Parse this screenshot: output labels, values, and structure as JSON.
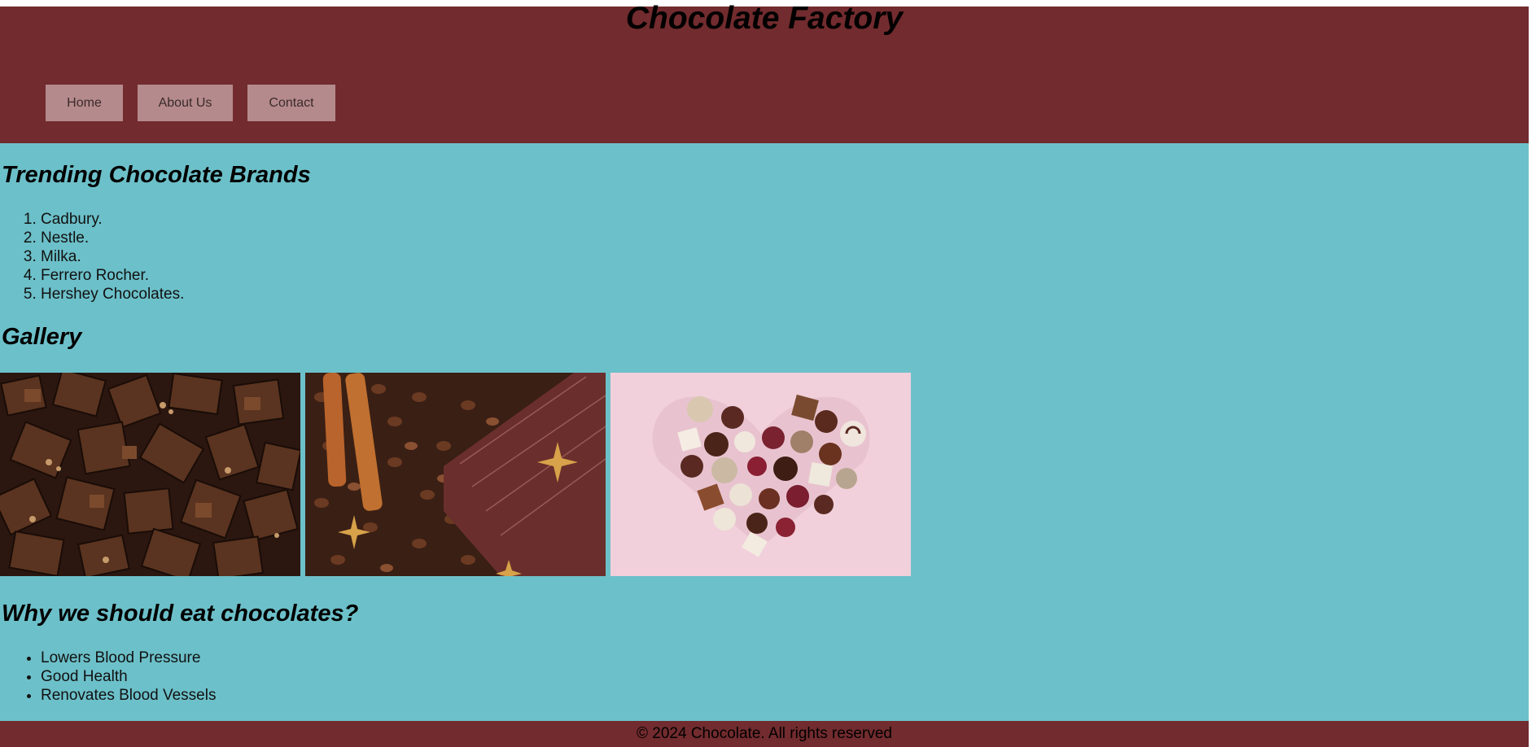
{
  "header": {
    "title": "Chocolate Factory",
    "nav": [
      {
        "label": "Home"
      },
      {
        "label": "About Us"
      },
      {
        "label": "Contact"
      }
    ]
  },
  "trending": {
    "heading": "Trending Chocolate Brands",
    "items": [
      "Cadbury.",
      "Nestle.",
      "Milka.",
      "Ferrero Rocher.",
      "Hershey Chocolates."
    ]
  },
  "gallery": {
    "heading": "Gallery",
    "images": [
      {
        "name": "chocolate-pieces-photo"
      },
      {
        "name": "chocolate-bar-coffee-beans-photo"
      },
      {
        "name": "chocolate-heart-photo"
      }
    ]
  },
  "why": {
    "heading": "Why we should eat chocolates?",
    "items": [
      "Lowers Blood Pressure",
      "Good Health",
      "Renovates Blood Vessels"
    ]
  },
  "footer": {
    "text": "© 2024 Chocolate. All rights reserved"
  },
  "colors": {
    "header_bg": "#722b2e",
    "body_bg": "#6cc0c9",
    "nav_button_bg": "#b58a8c"
  }
}
